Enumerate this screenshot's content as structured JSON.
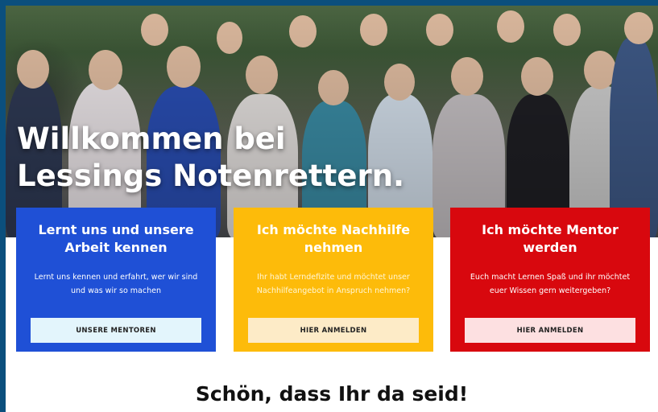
{
  "hero": {
    "title": "Willkommen bei Lessings Notenrettern."
  },
  "cards": [
    {
      "title": "Lernt uns und unsere Arbeit kennen",
      "text": "Lernt uns kennen und erfahrt, wer wir sind und was wir so machen",
      "button": "UNSERE MENTOREN",
      "color": "#1f50d6"
    },
    {
      "title": "Ich möchte Nachhilfe nehmen",
      "text": "Ihr habt Lerndefizite und möchtet unser Nachhilfeangebot in Anspruch nehmen?",
      "button": "HIER ANMELDEN",
      "color": "#fdbb0a"
    },
    {
      "title": "Ich möchte Mentor werden",
      "text": "Euch macht Lernen Spaß und ihr möchtet euer Wissen gern weitergeben?",
      "button": "HIER ANMELDEN",
      "color": "#d8080e"
    }
  ],
  "section": {
    "heading": "Schön, dass Ihr da seid!"
  }
}
